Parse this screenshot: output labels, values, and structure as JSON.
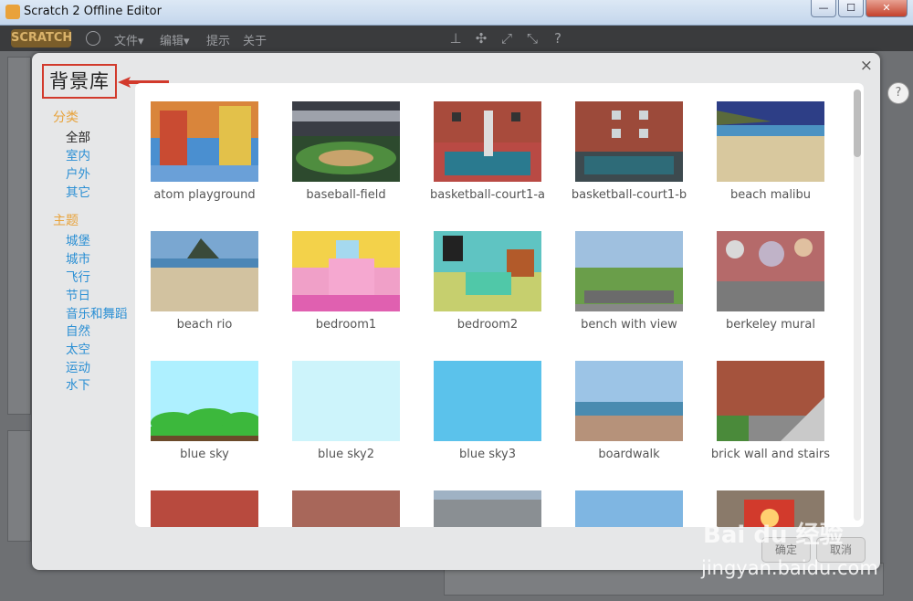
{
  "window": {
    "title": "Scratch 2 Offline Editor",
    "min": "—",
    "max": "☐",
    "close": "✕"
  },
  "menubar": {
    "logo": "SCRATCH",
    "file": "文件▾",
    "edit": "编辑▾",
    "tips": "提示",
    "about": "关于"
  },
  "dialog": {
    "title": "背景库",
    "close": "×",
    "category_header": "分类",
    "categories": [
      "全部",
      "室内",
      "户外",
      "其它"
    ],
    "theme_header": "主题",
    "themes": [
      "城堡",
      "城市",
      "飞行",
      "节日",
      "音乐和舞蹈",
      "自然",
      "太空",
      "运动",
      "水下"
    ],
    "items": [
      "atom playground",
      "baseball-field",
      "basketball-court1-a",
      "basketball-court1-b",
      "beach malibu",
      "beach rio",
      "bedroom1",
      "bedroom2",
      "bench with view",
      "berkeley mural",
      "blue sky",
      "blue sky2",
      "blue sky3",
      "boardwalk",
      "brick wall and stairs",
      "",
      "",
      "",
      "",
      ""
    ],
    "ok": "确定",
    "cancel": "取消"
  },
  "watermark": {
    "brand": "Bai du 经验",
    "url": "jingyan.baidu.com"
  }
}
